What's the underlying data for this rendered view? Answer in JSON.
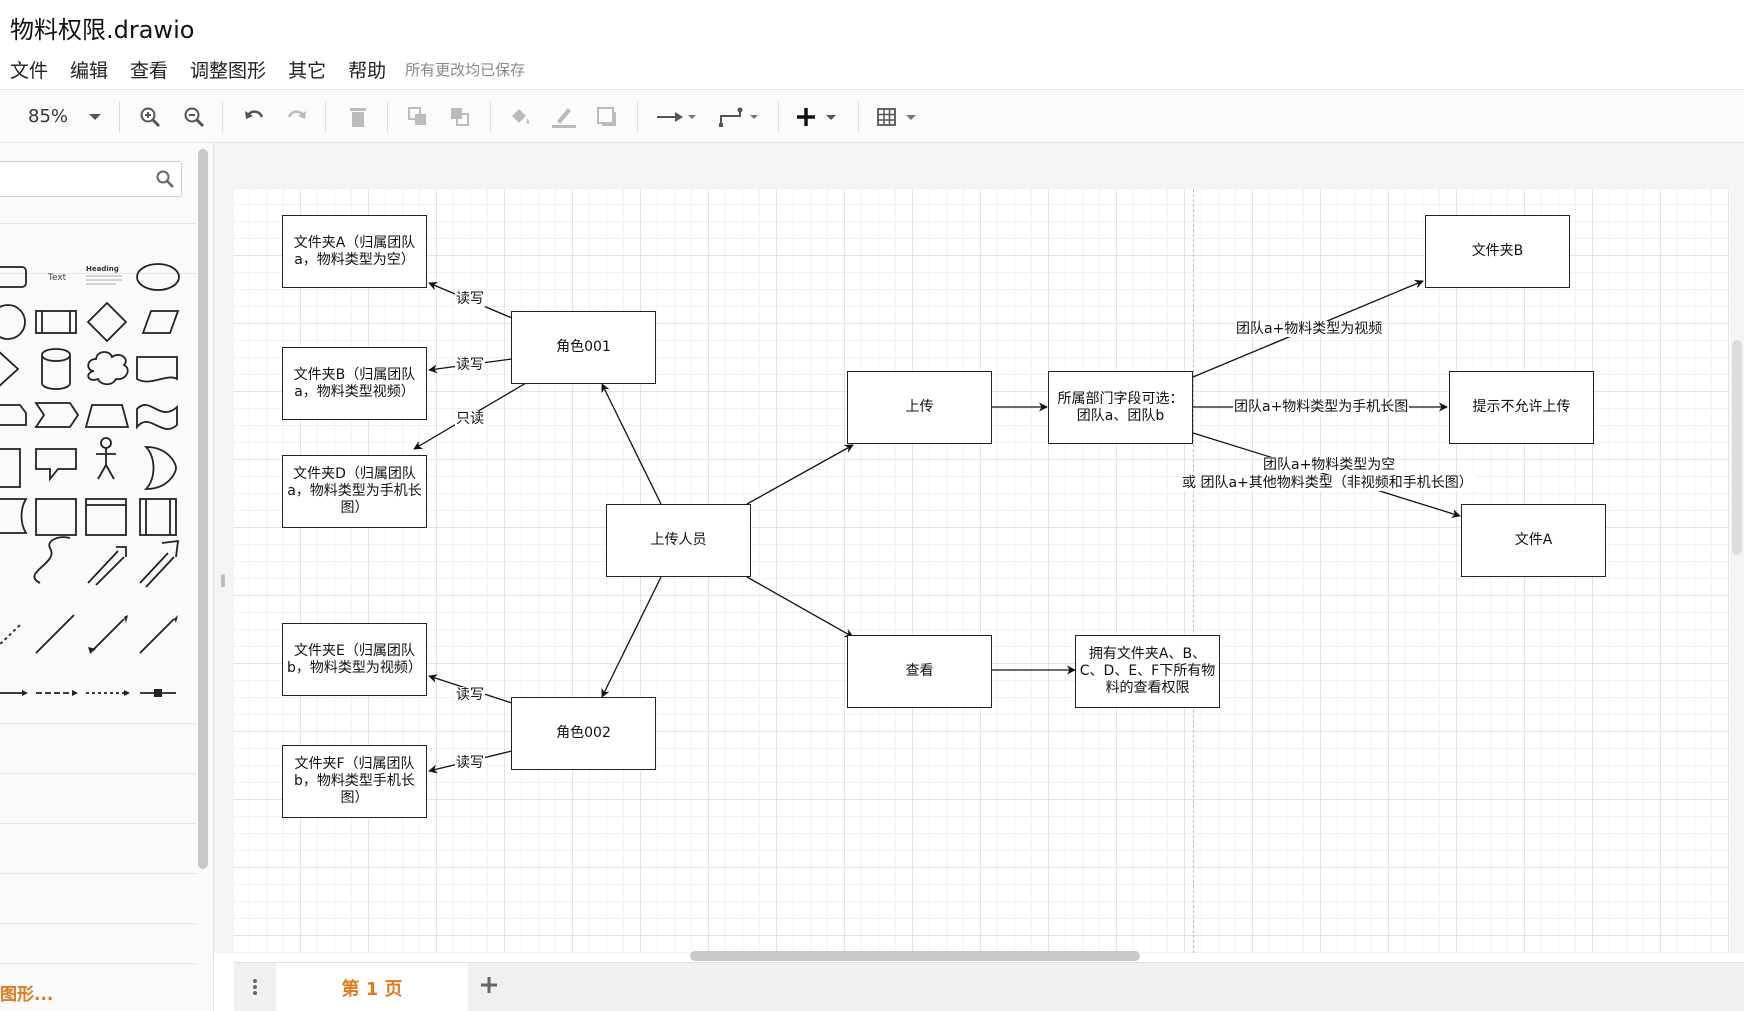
{
  "window": {
    "title": "物料权限.drawio"
  },
  "menu": {
    "items": [
      "文件",
      "编辑",
      "查看",
      "调整图形",
      "其它",
      "帮助"
    ],
    "save_status": "所有更改均已保存"
  },
  "toolbar": {
    "zoom": "85%",
    "icons": [
      "chevron-down-icon",
      "zoom-in-icon",
      "zoom-out-icon",
      "undo-icon",
      "redo-icon",
      "delete-icon",
      "to-front-icon",
      "to-back-icon",
      "fill-color-icon",
      "line-color-icon",
      "shadow-icon",
      "connection-icon",
      "waypoints-icon",
      "insert-plus-icon",
      "table-icon"
    ]
  },
  "sidebar": {
    "search_placeholder": "",
    "shape_text_label": "Text",
    "shape_heading_label": "Heading",
    "more_shapes": "图形..."
  },
  "diagram": {
    "nodes": {
      "folderA": "文件夹A（归属团队a，物料类型为空）",
      "folderB_left": "文件夹B（归属团队a，物料类型视频）",
      "folderD": "文件夹D（归属团队a，物料类型为手机长图）",
      "folderE": "文件夹E（归属团队b，物料类型为视频）",
      "folderF": "文件夹F（归属团队b，物料类型手机长图）",
      "role001": "角色001",
      "role002": "角色002",
      "uploader": "上传人员",
      "upload": "上传",
      "view": "查看",
      "dept_select": "所属部门字段可选：团队a、团队b",
      "view_perm": "拥有文件夹A、B、C、D、E、F下所有物料的查看权限",
      "folderB_right": "文件夹B",
      "no_upload": "提示不允许上传",
      "fileA": "文件A"
    },
    "edge_labels": {
      "rw1": "读写",
      "rw2": "读写",
      "ro": "只读",
      "rw3": "读写",
      "rw4": "读写",
      "video": "团队a+物料类型为视频",
      "long_image": "团队a+物料类型为手机长图",
      "empty_line1": "团队a+物料类型为空",
      "empty_line2": "或 团队a+其他物料类型（非视频和手机长图）"
    }
  },
  "pages": {
    "current": "第 1 页"
  }
}
